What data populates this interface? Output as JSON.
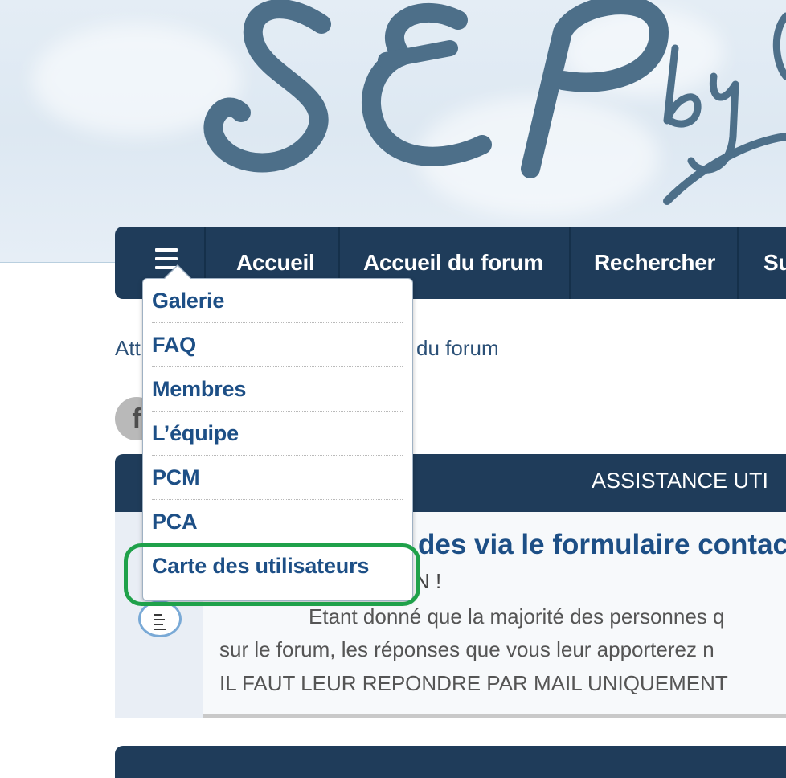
{
  "banner": {
    "logo_text": "SEP",
    "logo_by": "by"
  },
  "navbar": {
    "items": [
      "Accueil",
      "Accueil du forum",
      "Rechercher",
      "Su"
    ]
  },
  "breadcrumb": {
    "lead": "Att",
    "tail": "du forum"
  },
  "social": {
    "facebook_glyph": "f"
  },
  "dropdown": {
    "items": [
      "Galerie",
      "FAQ",
      "Membres",
      "L’équipe",
      "PCM",
      "PCA",
      "Carte des utilisateurs"
    ]
  },
  "section": {
    "title": "ASSISTANCE UTI"
  },
  "topic": {
    "title": "des via le formulaire contac",
    "subtitle": "N !",
    "lines": [
      "Etant donné que la majorité des personnes q",
      "sur le forum, les réponses que vous leur apporterez n",
      "IL FAUT LEUR REPONDRE PAR MAIL UNIQUEMENT"
    ]
  },
  "colors": {
    "nav": "#1f3c5a",
    "link": "#1d4f86",
    "highlight": "#1fa14a"
  }
}
